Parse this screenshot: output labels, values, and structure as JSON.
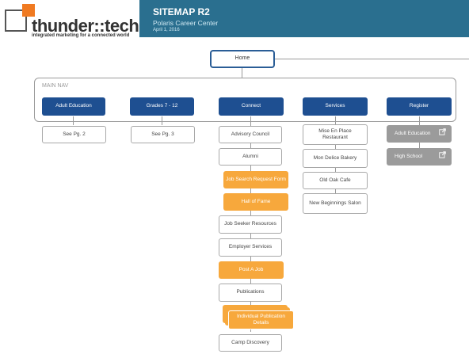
{
  "logo": {
    "name": "thunder::tech",
    "tagline": "integrated marketing for a connected world"
  },
  "header": {
    "title": "SITEMAP R2",
    "subtitle": "Polaris Career Center",
    "date": "April 1, 2016"
  },
  "home": "Home",
  "main_nav": {
    "label": "MAIN NAV",
    "items": [
      "Adult Education",
      "Grades 7 - 12",
      "Connect",
      "Services",
      "Register"
    ]
  },
  "adult_education": [
    "See Pg. 2"
  ],
  "grades": [
    "See Pg. 3"
  ],
  "connect": [
    "Advisory Council",
    "Alumni",
    "Job Search Request Form",
    "Hall of Fame",
    "Job Seeker Resources",
    "Employer Services",
    "Post A Job",
    "Publications",
    "Individual Publication Details",
    "Camp Discovery"
  ],
  "services": [
    "Mise En Place Restaurant",
    "Mon Delice Bakery",
    "Old Oak Cafe",
    "New Beginnings Salon"
  ],
  "register": [
    "Adult Education",
    "High School"
  ],
  "colors": {
    "nav": "#1e4f91",
    "highlight": "#f7a83c",
    "external": "#9b9b9b",
    "header": "#2a6f8f",
    "logo_accent": "#f07a21"
  }
}
